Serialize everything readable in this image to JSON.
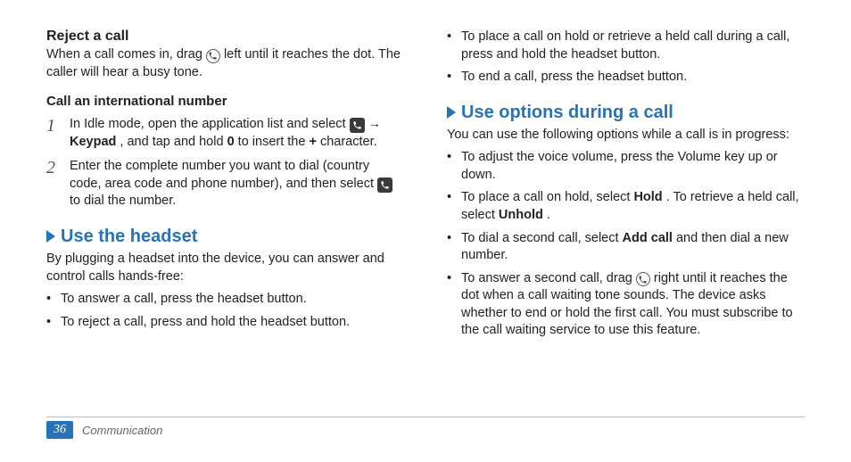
{
  "left": {
    "reject_heading": "Reject a call",
    "reject_para_a": "When a call comes in, drag ",
    "reject_para_b": " left until it reaches the dot. The caller will hear a busy tone.",
    "intl_heading": "Call an international number",
    "step1_a": "In Idle mode, open the application list and select ",
    "step1_b": " → ",
    "step1_c": "Keypad",
    "step1_d": ", and tap and hold ",
    "step1_e": "0",
    "step1_f": " to insert the ",
    "step1_g": "+",
    "step1_h": " character.",
    "step2_a": "Enter the complete number you want to dial (country code, area code and phone number), and then select ",
    "step2_b": " to dial the number.",
    "headset_heading": "Use the headset",
    "headset_para": "By plugging a headset into the device, you can answer and control calls hands-free:",
    "headset_b1": "To answer a call, press the headset button.",
    "headset_b2": "To reject a call, press and hold the headset button."
  },
  "right": {
    "top_b1": "To place a call on hold or retrieve a held call during a call, press and hold the headset button.",
    "top_b2": "To end a call, press the headset button.",
    "options_heading": "Use options during a call",
    "options_para": "You can use the following options while a call is in progress:",
    "opt_b1": "To adjust the voice volume, press the Volume key up or down.",
    "opt_b2_a": "To place a call on hold, select ",
    "opt_b2_b": "Hold",
    "opt_b2_c": ". To retrieve a held call, select ",
    "opt_b2_d": "Unhold",
    "opt_b2_e": ".",
    "opt_b3_a": "To dial a second call, select ",
    "opt_b3_b": "Add call",
    "opt_b3_c": " and then dial a new number.",
    "opt_b4_a": "To answer a second call, drag ",
    "opt_b4_b": " right until it reaches the dot when a call waiting tone sounds. The device asks whether to end or hold the first call. You must subscribe to the call waiting service to use this feature."
  },
  "footer": {
    "page": "36",
    "section": "Communication"
  },
  "nums": {
    "one": "1",
    "two": "2"
  }
}
